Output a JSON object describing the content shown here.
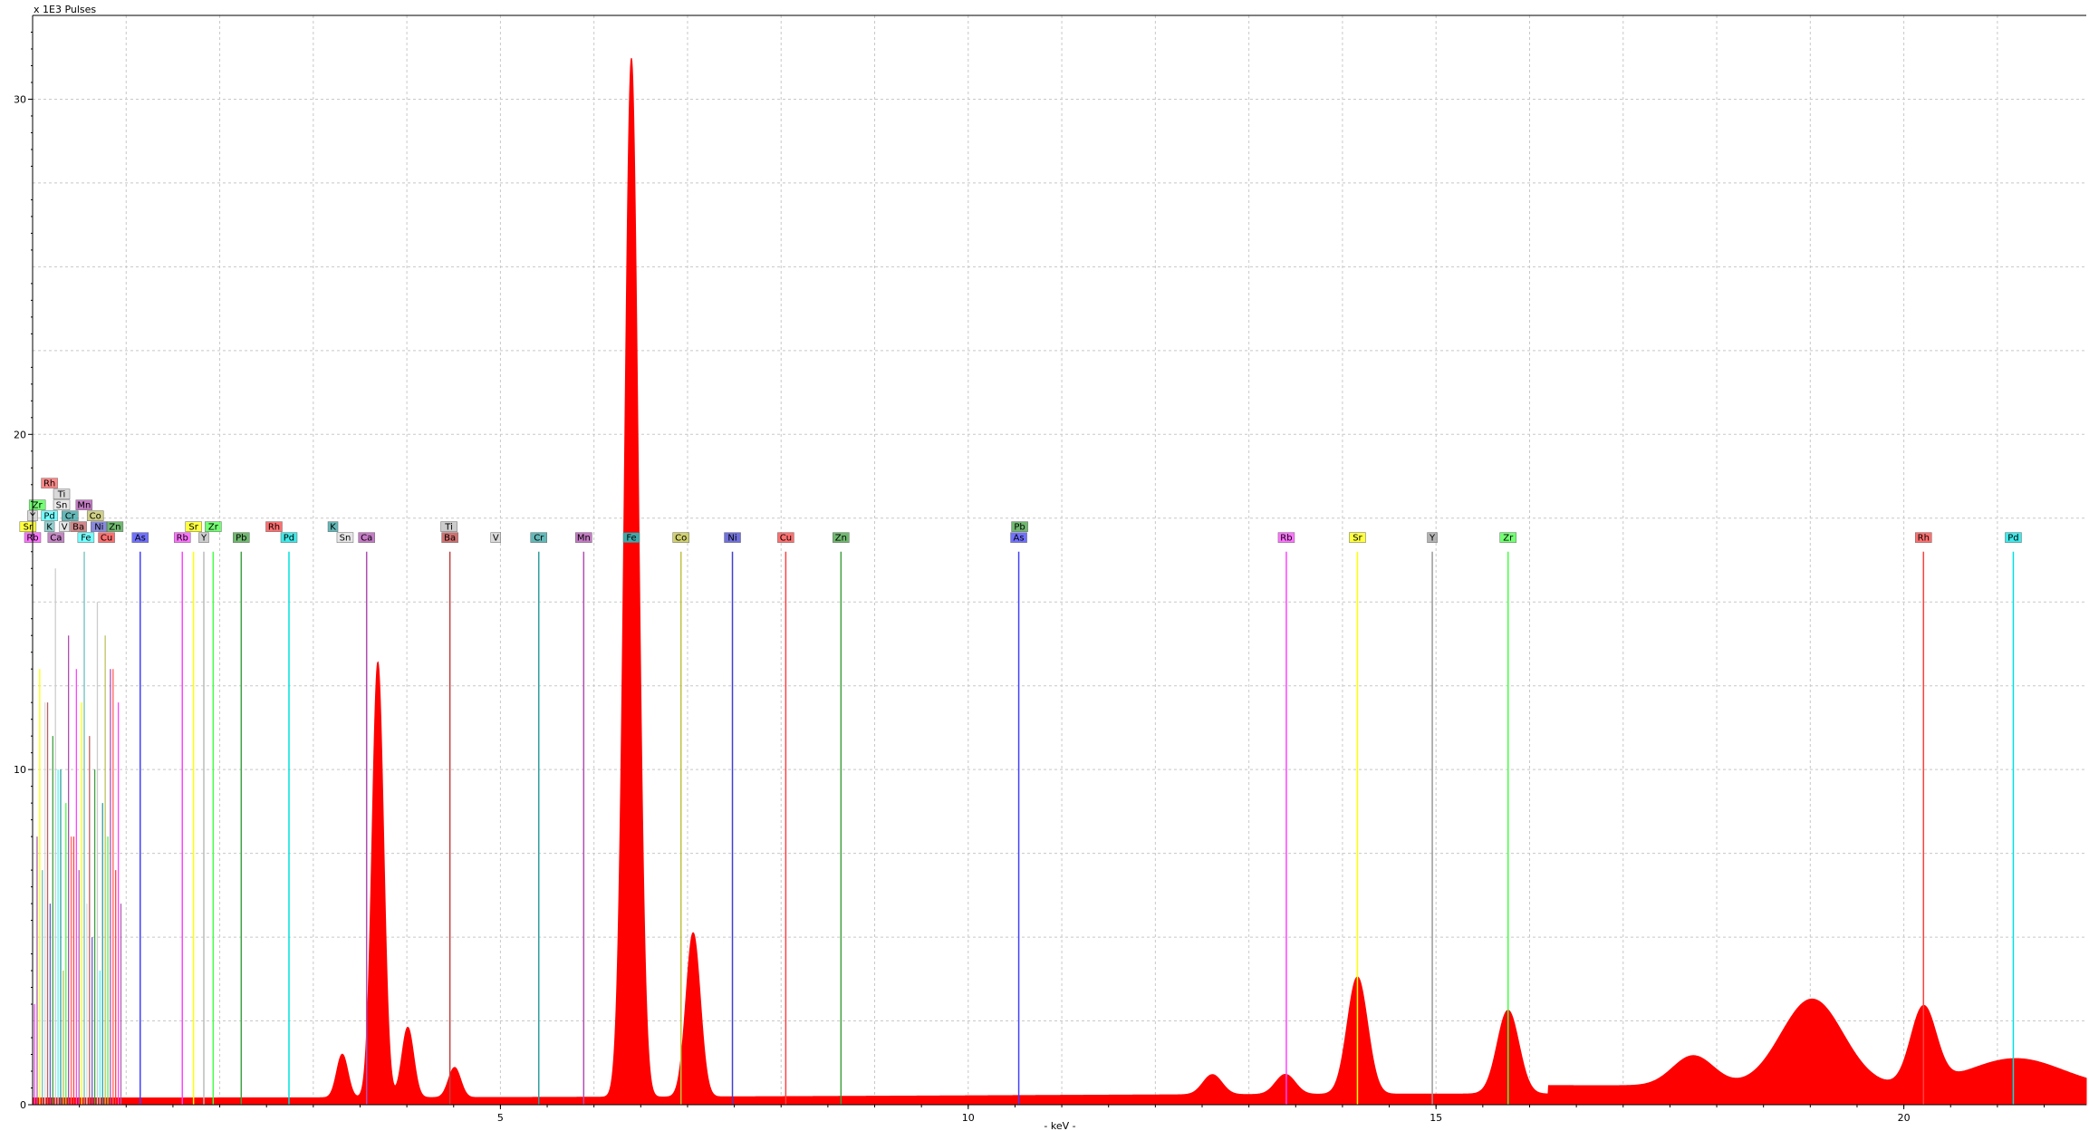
{
  "chart_data": {
    "type": "line",
    "title": "",
    "ylabel": "x 1E3 Pulses",
    "xlabel": "- keV -",
    "xlim": [
      0,
      21.95
    ],
    "ylim": [
      0,
      32.5
    ],
    "x_ticks": [
      {
        "value": 5,
        "label": "5"
      },
      {
        "value": 10,
        "label": "10"
      },
      {
        "value": 15,
        "label": "15"
      },
      {
        "value": 20,
        "label": "20"
      }
    ],
    "y_ticks": [
      {
        "value": 0,
        "label": "0"
      },
      {
        "value": 10,
        "label": "10"
      },
      {
        "value": 20,
        "label": "20"
      },
      {
        "value": 30,
        "label": "30"
      }
    ],
    "grid": true,
    "spectrum": {
      "color": "#ff0000",
      "baseline": 0.2,
      "peaks": [
        {
          "x": 6.4,
          "y": 31.0
        },
        {
          "x": 7.06,
          "y": 4.9
        },
        {
          "x": 3.69,
          "y": 13.0
        },
        {
          "x": 4.01,
          "y": 2.1
        },
        {
          "x": 3.31,
          "y": 1.3
        },
        {
          "x": 4.51,
          "y": 0.9
        },
        {
          "x": 14.16,
          "y": 3.5
        },
        {
          "x": 15.77,
          "y": 2.5
        },
        {
          "x": 19.02,
          "y": 2.6
        },
        {
          "x": 20.21,
          "y": 2.3
        },
        {
          "x": 21.2,
          "y": 0.85
        },
        {
          "x": 13.39,
          "y": 0.6
        },
        {
          "x": 17.75,
          "y": 0.9
        },
        {
          "x": 12.61,
          "y": 0.6
        }
      ]
    },
    "element_lines": [
      {
        "label": "Rb",
        "x": 0.0,
        "color": "#ff44ff",
        "row": 0,
        "height": 0
      },
      {
        "label": "Ca",
        "x": 0.25,
        "color": "#b05fb0",
        "row": 0,
        "height": 0
      },
      {
        "label": "Sr",
        "x": -0.05,
        "color": "#ffff00",
        "row": 1,
        "height": 0
      },
      {
        "label": "K",
        "x": 0.18,
        "color": "#6fbfbf",
        "row": 1,
        "height": 0
      },
      {
        "label": "V",
        "x": 0.34,
        "color": "#dddddd",
        "row": 1,
        "height": 0
      },
      {
        "label": "Ba",
        "x": 0.49,
        "color": "#c06060",
        "row": 1,
        "height": 0
      },
      {
        "label": "Ni",
        "x": 0.71,
        "color": "#6060d0",
        "row": 1,
        "height": 0
      },
      {
        "label": "Zn",
        "x": 0.88,
        "color": "#3fa03f",
        "row": 1,
        "height": 0
      },
      {
        "label": "Y",
        "x": 0.0,
        "color": "#cccccc",
        "row": 2,
        "height": 0
      },
      {
        "label": "Pd",
        "x": 0.18,
        "color": "#44ffff",
        "row": 2,
        "height": 0
      },
      {
        "label": "Cr",
        "x": 0.4,
        "color": "#2f9f9f",
        "row": 2,
        "height": 0
      },
      {
        "label": "Co",
        "x": 0.67,
        "color": "#c0c060",
        "row": 2,
        "height": 0
      },
      {
        "label": "Zr",
        "x": 0.05,
        "color": "#44ff44",
        "row": 3,
        "height": 0
      },
      {
        "label": "Sn",
        "x": 0.31,
        "color": "#e0e0e0",
        "row": 3,
        "height": 0
      },
      {
        "label": "Mn",
        "x": 0.55,
        "color": "#b04fb0",
        "row": 3,
        "height": 0
      },
      {
        "label": "Ti",
        "x": 0.31,
        "color": "#cccccc",
        "row": 4,
        "height": 0
      },
      {
        "label": "Rh",
        "x": 0.18,
        "color": "#ff6060",
        "row": 5,
        "height": 0
      },
      {
        "label": "Fe",
        "x": 0.57,
        "color": "#44ffff",
        "row": 0,
        "height": 0
      },
      {
        "label": "Cu",
        "x": 0.79,
        "color": "#ff4040",
        "row": 0,
        "height": 0
      },
      {
        "label": "As",
        "x": 1.15,
        "color": "#4040ff",
        "row": 0,
        "height": 7.5
      },
      {
        "label": "Rb",
        "x": 1.6,
        "color": "#ff44ff",
        "row": 0,
        "height": 7.6
      },
      {
        "label": "Sr",
        "x": 1.72,
        "color": "#ffff00",
        "row": 1,
        "height": 7.6
      },
      {
        "label": "Y",
        "x": 1.83,
        "color": "#bbbbbb",
        "row": 0,
        "height": 7.5
      },
      {
        "label": "Zr",
        "x": 1.93,
        "color": "#44ff44",
        "row": 1,
        "height": 7.5
      },
      {
        "label": "Pb",
        "x": 2.23,
        "color": "#3fa03f",
        "row": 0,
        "height": 9.6
      },
      {
        "label": "Rh",
        "x": 2.58,
        "color": "#ff4040",
        "row": 1,
        "height": 0
      },
      {
        "label": "Pd",
        "x": 2.74,
        "color": "#00e0e0",
        "row": 0,
        "height": 6.8
      },
      {
        "label": "K",
        "x": 3.21,
        "color": "#2f9f9f",
        "row": 1,
        "height": 0
      },
      {
        "label": "Sn",
        "x": 3.34,
        "color": "#dddddd",
        "row": 0,
        "height": 0
      },
      {
        "label": "Ca",
        "x": 3.57,
        "color": "#b04fb0",
        "row": 0,
        "height": 8.2
      },
      {
        "label": "Ti",
        "x": 4.45,
        "color": "#bbbbbb",
        "row": 1,
        "height": 0
      },
      {
        "label": "Ba",
        "x": 4.46,
        "color": "#c04040",
        "row": 0,
        "height": 1.8
      },
      {
        "label": "V",
        "x": 4.95,
        "color": "#cccccc",
        "row": 0,
        "height": 0
      },
      {
        "label": "Cr",
        "x": 5.41,
        "color": "#2f9f9f",
        "row": 0,
        "height": 8.2
      },
      {
        "label": "Mn",
        "x": 5.89,
        "color": "#b04fb0",
        "row": 0,
        "height": 8.2
      },
      {
        "label": "Fe",
        "x": 6.4,
        "color": "#00e0e0",
        "row": 0,
        "height": 0
      },
      {
        "label": "Co",
        "x": 6.93,
        "color": "#c0c040",
        "row": 0,
        "height": 8.2
      },
      {
        "label": "Ni",
        "x": 7.48,
        "color": "#4040d0",
        "row": 0,
        "height": 8.2
      },
      {
        "label": "Cu",
        "x": 8.05,
        "color": "#ff4040",
        "row": 0,
        "height": 8.2
      },
      {
        "label": "Zn",
        "x": 8.64,
        "color": "#3fa03f",
        "row": 0,
        "height": 8.2
      },
      {
        "label": "Pb",
        "x": 10.55,
        "color": "#3fa03f",
        "row": 1,
        "height": 0
      },
      {
        "label": "As",
        "x": 10.54,
        "color": "#4040ff",
        "row": 0,
        "height": 8.3
      },
      {
        "label": "Rb",
        "x": 13.4,
        "color": "#ff44ff",
        "row": 0,
        "height": 8.4
      },
      {
        "label": "Sr",
        "x": 14.16,
        "color": "#ffff00",
        "row": 0,
        "height": 8.4
      },
      {
        "label": "Y",
        "x": 14.96,
        "color": "#999999",
        "row": 0,
        "height": 8.4
      },
      {
        "label": "Zr",
        "x": 15.77,
        "color": "#44ff44",
        "row": 0,
        "height": 8.4
      },
      {
        "label": "Rh",
        "x": 20.21,
        "color": "#ff4040",
        "row": 0,
        "height": 8.6
      },
      {
        "label": "Pd",
        "x": 21.17,
        "color": "#00e0e0",
        "row": 0,
        "height": 8.6
      }
    ]
  }
}
